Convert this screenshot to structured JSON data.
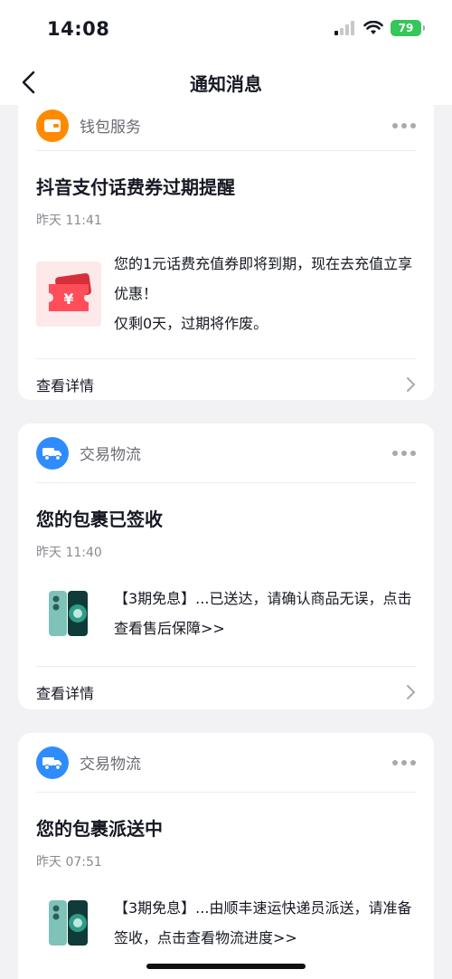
{
  "status_bar": {
    "time": "14:08",
    "battery": "79"
  },
  "nav": {
    "title": "通知消息"
  },
  "cards": [
    {
      "source": "钱包服务",
      "title": "抖音支付话费券过期提醒",
      "time": "昨天 11:41",
      "text_line1": " 您的1元话费充值券即将到期，现在去充值立享优惠！",
      "text_line2": "仅剩0天，过期将作废。",
      "footer": "查看详情"
    },
    {
      "source": "交易物流",
      "title": "您的包裹已签收",
      "time": "昨天 11:40",
      "text_line1": "【3期免息】...已送达，请确认商品无误，点击查看售后保障>>",
      "footer": "查看详情"
    },
    {
      "source": "交易物流",
      "title": "您的包裹派送中",
      "time": "昨天 07:51",
      "text_line1": "【3期免息】...由顺丰速运快递员派送，请准备签收，点击查看物流进度>>"
    }
  ],
  "colors": {
    "wallet": "#ff8a00",
    "logistics": "#2f8cff",
    "coupon": "#ff4d5a",
    "battery": "#34c759"
  }
}
